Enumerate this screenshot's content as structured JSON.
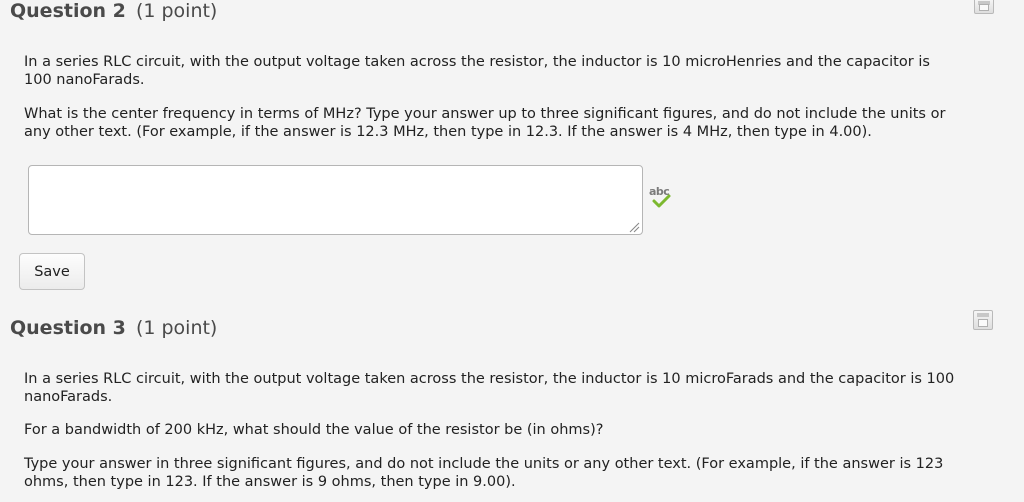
{
  "question2": {
    "number": "Question 2",
    "points": "(1 point)",
    "paragraph1_line1": "In a series RLC circuit, with the output voltage taken across the resistor, the inductor is 10 microHenries and the capacitor is",
    "paragraph1_line2": "100 nanoFarads.",
    "paragraph2_line1": "What is the center frequency in terms of MHz? Type your answer up to three significant figures, and do not include the units or",
    "paragraph2_line2": "any other text. (For example, if the answer is 12.3 MHz, then type in 12.3. If the answer is 4 MHz, then type in 4.00).",
    "answer_value": "",
    "spellcheck_icon": "abc-check-icon",
    "save_label": "Save",
    "save_icon": "floppy-disk-icon"
  },
  "question3": {
    "number": "Question 3",
    "points": "(1 point)",
    "paragraph1_line1": "In a series RLC circuit, with the output voltage taken across the resistor, the inductor is 10 microFarads and the capacitor is 100",
    "paragraph1_line2": "nanoFarads.",
    "paragraph2_line1": "For a bandwidth of 200 kHz, what should the value of the resistor be (in ohms)?",
    "paragraph3_line1": "Type your answer in three significant figures, and do not include the units or any other text. (For example, if the answer is 123",
    "paragraph3_line2": "ohms, then type in 123. If the answer is 9 ohms, then type in 9.00).",
    "save_icon": "floppy-disk-icon"
  },
  "colors": {
    "background": "#f4f4f4",
    "heading": "#4a4a4a",
    "text": "#222222",
    "spellcheck_green": "#7cb82f"
  }
}
